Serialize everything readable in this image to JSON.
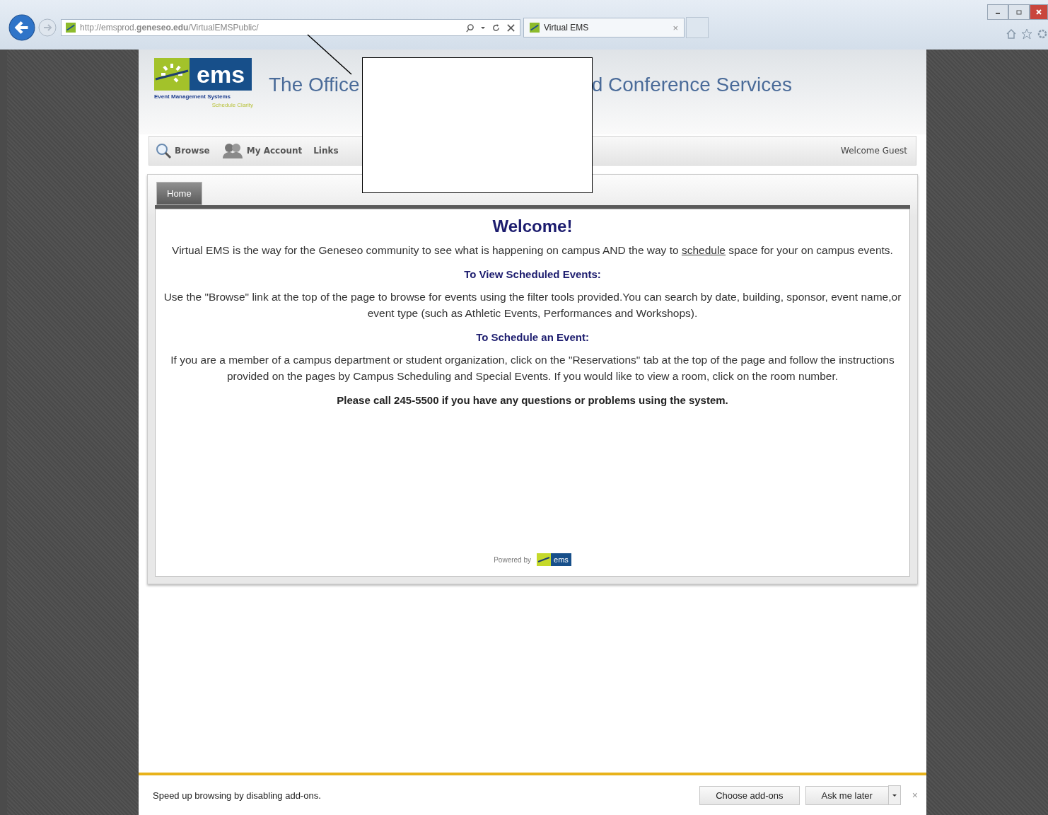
{
  "browser": {
    "address": "http://emsprod.**geneseo.edu**/VirtualEMSPublic/",
    "tabs": [
      {
        "label": "Virtual EMS",
        "close": "×",
        "selected": true
      }
    ]
  },
  "header": {
    "logo": {
      "wordmark": "ems",
      "tagline": "Event Management Systems",
      "slogan": "Schedule Clarity"
    },
    "title_parts": [
      "The Office",
      "d Conference Services"
    ]
  },
  "nav": {
    "items": [
      {
        "label": "Browse",
        "kind": "search"
      },
      {
        "label": "My Account",
        "kind": "account"
      },
      {
        "label": "Links",
        "kind": "plain"
      }
    ],
    "greeting": "Welcome Guest"
  },
  "tabs": [
    {
      "label": "Home",
      "selected": true
    }
  ],
  "content": {
    "heading": "Welcome!",
    "blocks": [
      {
        "kind": "intro",
        "before": "Virtual EMS is the way for the Geneseo community to see what is happening on campus AND the way to ",
        "link": "schedule",
        "after": " space for your on campus events."
      },
      {
        "kind": "subheading",
        "text": "To View Scheduled Events:"
      },
      {
        "kind": "text",
        "text": "Use the \"Browse\" link at the top of the page to browse for events using the filter tools provided.You can search by date, building, sponsor, event name,or event type (such as Athletic Events, Performances and Workshops)."
      },
      {
        "kind": "subheading",
        "text": "To Schedule an Event:"
      },
      {
        "kind": "text",
        "text": "If you are a member of a campus department or student organization, click on the \"Reservations\" tab at the top of the page and follow the instructions provided on the pages by Campus Scheduling and Special Events.  If you would like to view a room, click on the room number."
      },
      {
        "kind": "note",
        "text": "Please call 245-5500 if you have any questions or problems using the system."
      }
    ]
  },
  "footer": {
    "powered_by": "Powered by",
    "logo": "ems"
  },
  "notification": {
    "message": "Speed up browsing by disabling add-ons.",
    "buttons": [
      "Choose add-ons",
      "Ask me later"
    ],
    "close": "×"
  }
}
